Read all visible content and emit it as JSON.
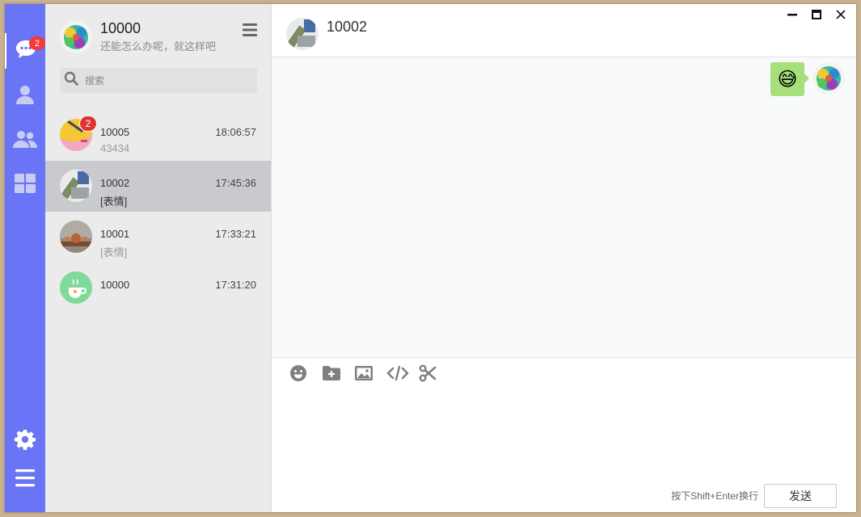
{
  "rail": {
    "chat_badge": "2",
    "items": [
      {
        "icon": "chat-icon"
      },
      {
        "icon": "user-icon"
      },
      {
        "icon": "group-icon"
      },
      {
        "icon": "apps-icon"
      },
      {
        "icon": "gear-icon"
      },
      {
        "icon": "menu-icon"
      }
    ]
  },
  "me": {
    "name": "10000",
    "signature": "还能怎么办呢，就这样吧"
  },
  "search": {
    "placeholder": "搜索"
  },
  "chats": [
    {
      "name": "10005",
      "time": "18:06:57",
      "last": "43434",
      "badge": "2"
    },
    {
      "name": "10002",
      "time": "17:45:36",
      "last": "[表情]"
    },
    {
      "name": "10001",
      "time": "17:33:21",
      "last": "[表情]"
    },
    {
      "name": "10000",
      "time": "17:31:20",
      "last": ""
    }
  ],
  "conversation": {
    "title": "10002",
    "messages": [
      {
        "from": "me",
        "type": "emoji",
        "content": "😅"
      }
    ]
  },
  "toolbar": [
    "emoji-icon",
    "folder-add-icon",
    "image-icon",
    "code-icon",
    "scissors-icon"
  ],
  "composer": {
    "hint": "按下Shift+Enter换行",
    "send_label": "发送"
  },
  "colors": {
    "rail": "#6974f6",
    "panel": "#ebebeb",
    "selected": "#c8cacd",
    "badge": "#e03333",
    "bubble": "#a6e07a"
  }
}
